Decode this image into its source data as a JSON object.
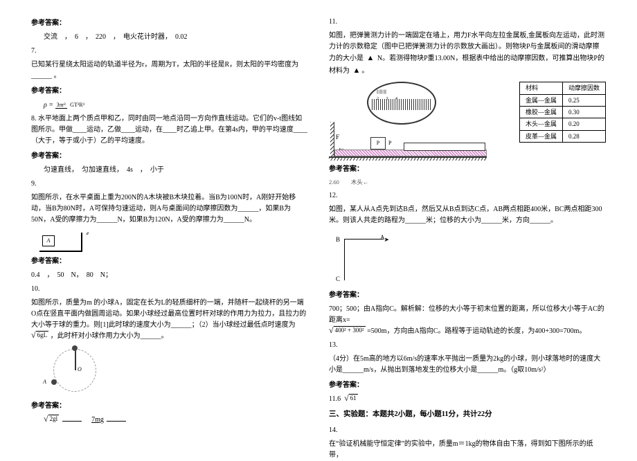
{
  "left": {
    "ans_label": "参考答案：",
    "ans6": "交流　，　6　，　220　，　电火花计时器，　0.02",
    "q7_num": "7.",
    "q7_text": "已知某行星绕太阳运动的轨道半径为r，周期为T，太阳的半径是R，则太阳的平均密度为______ 。",
    "ans7_formula_lhs": "ρ =",
    "ans7_num": "3πr³",
    "ans7_den": "GT²R³",
    "q8_text": "8. 水平地面上两个质点甲和乙，同时由同一地点沿同一方向作直线运动。它们的v-t图线如图所示。甲做____运动，乙做____运动，在____时乙追上甲。在第4s内，甲的平均速度____（大于，等于或小于）乙的平均速度。",
    "ans8": "匀速直线，　匀加速直线，　4s　，　小于",
    "q9_num": "9.",
    "q9_text": "如图所示，在水平桌面上重为200N的A木块被B木块拉着。当B为100N时，A刚好开始移动，当B为80N时，A可保持匀速运动，则A与桌面间的动摩擦因数为______，如果B为50N，A受的摩擦力为______N，如果B为120N，A受的摩擦力为______N。",
    "q9_box": "A",
    "ans9": "0.4　，　50　N，　80　N；",
    "q10_num": "10.",
    "q10_text_a": "如图所示，质量为m 的小球A，固定在长为L的轻质细杆的一端，并随杆一起绕杆的另一端O点在竖直平面内做圆周运动。如果小球经过最高位置时杆对球的作用力为拉力，且拉力的大小等于球的重力。则[1]此时球的速度大小为______；（2）当小球经过最低点时速度为",
    "q10_text_b": "，此时杆对小球作用力大小为______。",
    "q10_label_O": "O",
    "q10_label_A": "A",
    "ans10_v": "2gl",
    "ans10_f": "7mg"
  },
  "right": {
    "q11_num": "11.",
    "q11_text_a": "如图，把弹簧测力计的一端固定在墙上，用力F水平向左拉金属板,金属板向左运动，此时测力计的示数稳定（图中已把弹簧测力计的示数放大画出）。则物块P与金属板间的滑动摩擦力的大小是",
    "q11_text_b": "N。若测得物块P重13.00N，根据表中给出的动摩擦因数，可推算出物块P的材料为",
    "q11_block": "P",
    "q11_Flabel": "F",
    "table": {
      "h1": "材料",
      "h2": "动摩擦因数",
      "r1c1": "金属—金属",
      "r1c2": "0.25",
      "r2c1": "橡胶—金属",
      "r2c2": "0.30",
      "r3c1": "木头—金属",
      "r3c2": "0.20",
      "r4c1": "皮革—金属",
      "r4c2": "0.28"
    },
    "ans11": "2.60　　木头←",
    "q12_num": "12.",
    "q12_text": "如图，某人从A点先到达B点，然后又从B点到达C点，AB两点相距400米，BC两点相距300米。则该人共走的路程为______米；位移的大小为______米，方向______。",
    "q12_B": "B",
    "q12_A": "A",
    "q12_C": "C",
    "ans12_a": "700；500；由A指向C。解析解：位移的大小等于初末位置的距离，所以位移大小等于AC的距离x=",
    "ans12_radicand": "400² + 300²",
    "ans12_b": "=500m，方向由A指向C。路程等于运动轨迹的长度，为400+300=700m。",
    "q13_num": "13.",
    "q13_text_a": "（4分）在5m高的地方以6m/s的速率水平抛出一质量为2kg的小球，则小球落地时的速度大小是______m/s，从抛出到落地发生的位移大小是______m。（g取10m/s²）",
    "ans13_a": "11.6",
    "ans13_radicand": "61",
    "section3": "三、实验题：本题共2小题，每小题11分，共计22分",
    "q14_num": "14.",
    "q14_text": "在“验证机械能守恒定律”的实验中，质量m＝1kg的物体自由下落，得到如下图所示的纸带，"
  }
}
